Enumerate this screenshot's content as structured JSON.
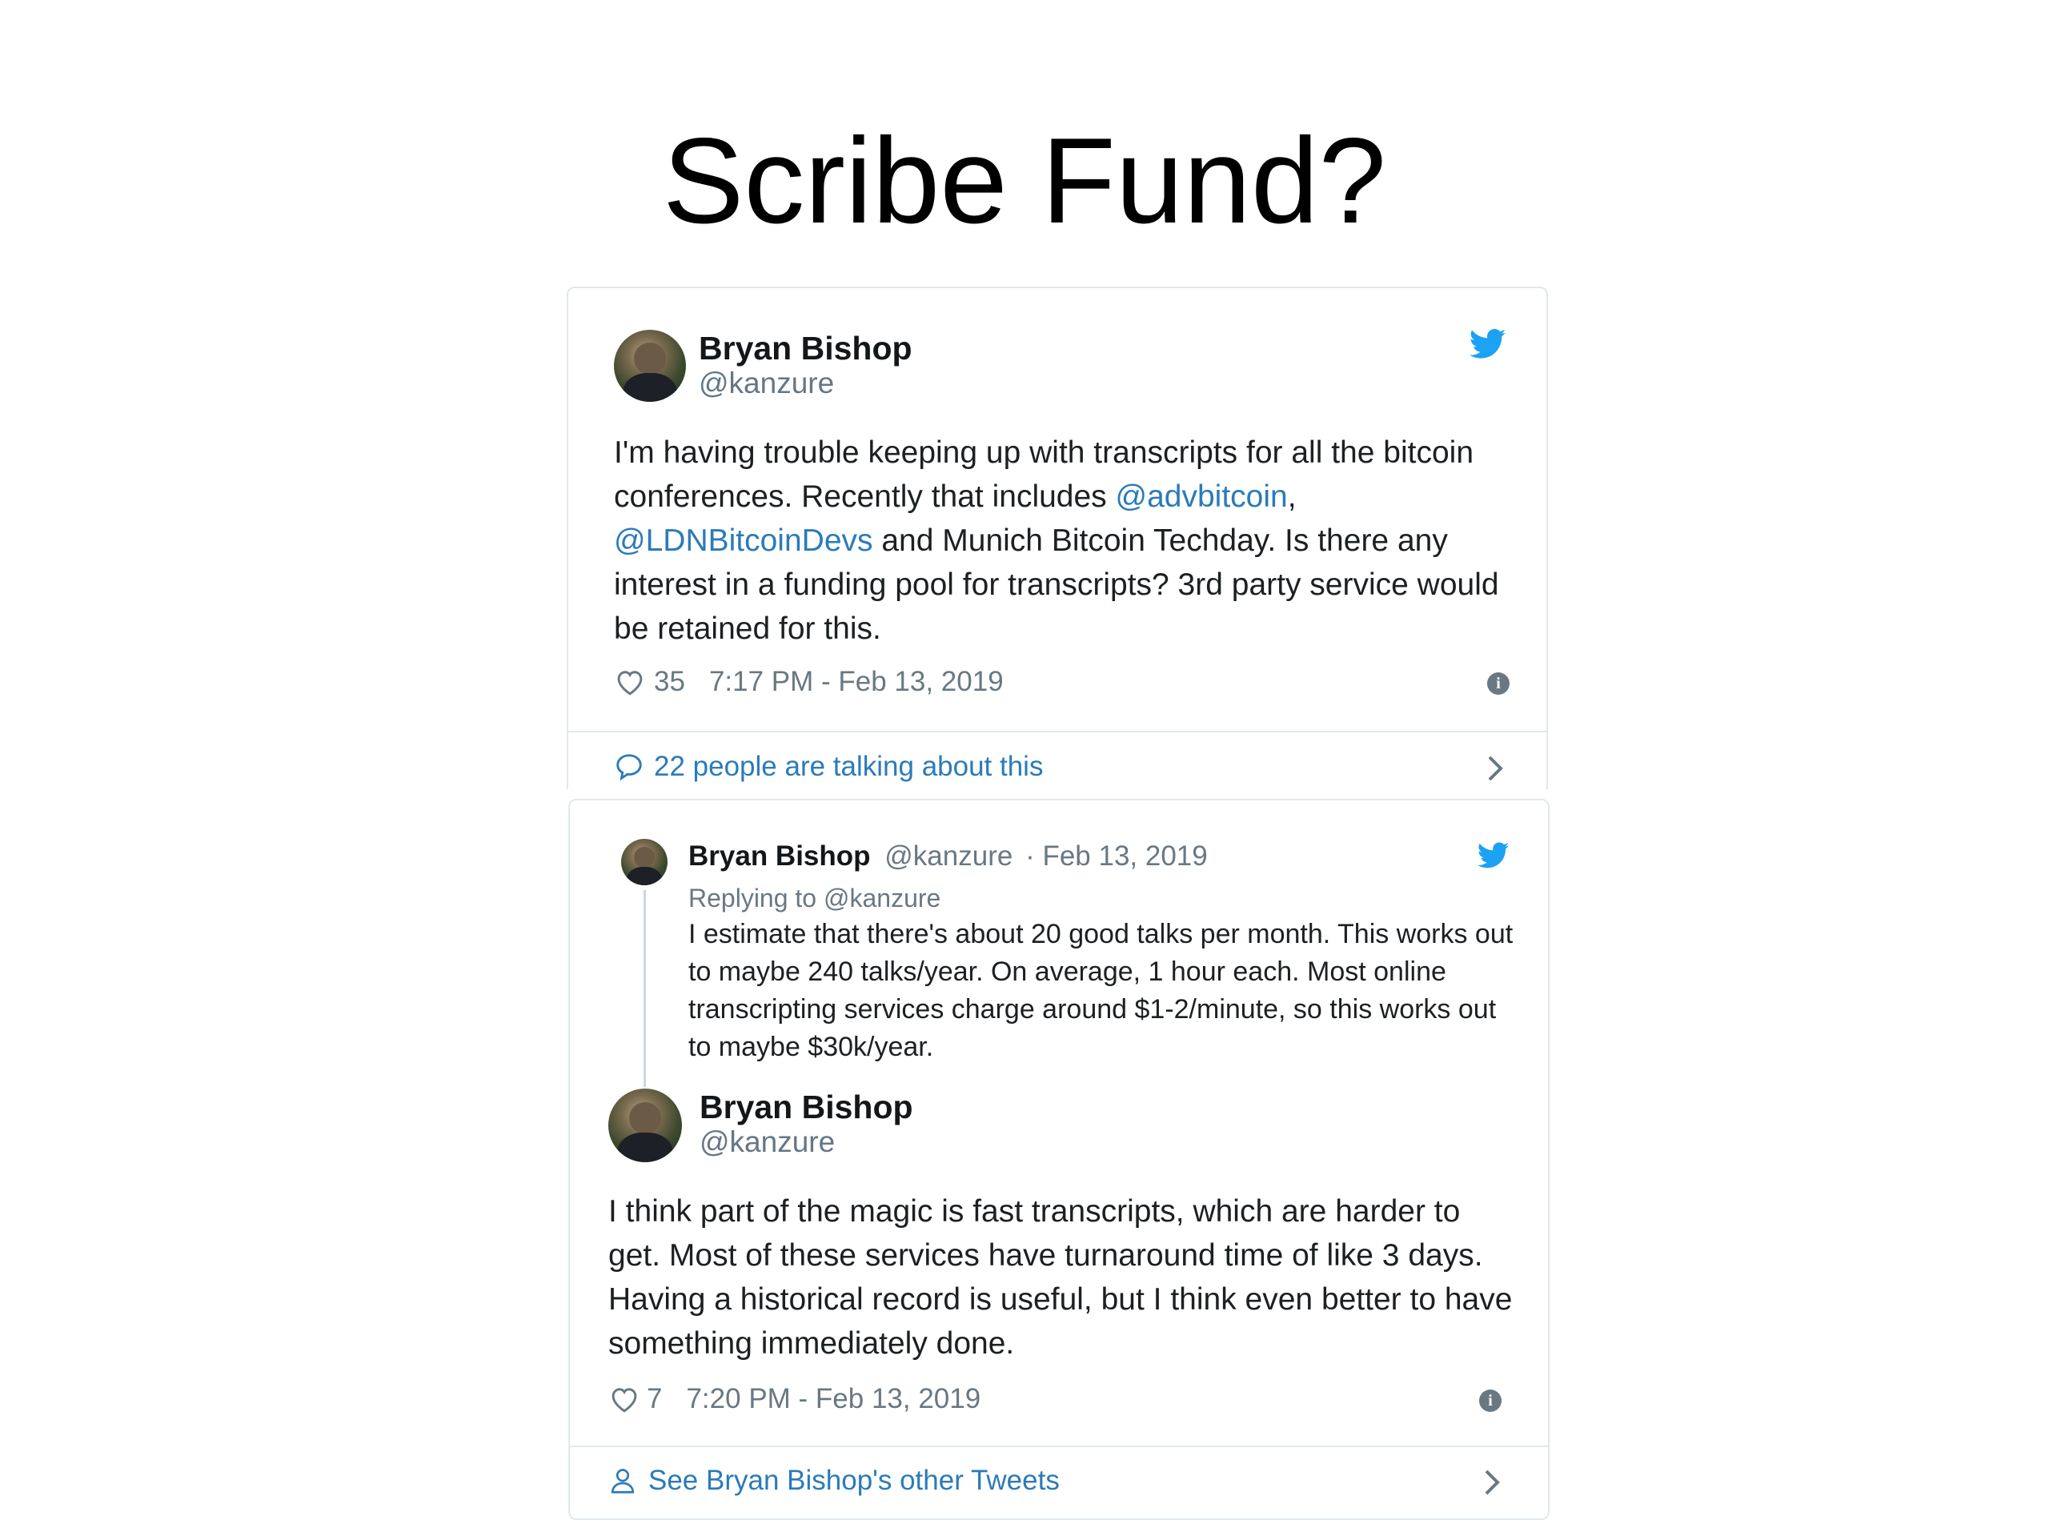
{
  "slide": {
    "title": "Scribe Fund?"
  },
  "tweet1": {
    "author_name": "Bryan Bishop",
    "author_handle": "@kanzure",
    "text_part1": "I'm having trouble keeping up with transcripts for all the bitcoin conferences. Recently that includes ",
    "mention1": "@advbitcoin",
    "comma": ",",
    "mention2": "@LDNBitcoinDevs",
    "text_part2": " and Munich Bitcoin Techday. Is there any interest in a funding pool for transcripts? 3rd party service would be retained for this.",
    "likes": "35",
    "timestamp": "7:17 PM - Feb 13, 2019",
    "conversation": "22 people are talking about this"
  },
  "tweet2": {
    "parent": {
      "author_name": "Bryan Bishop",
      "author_handle": "@kanzure",
      "date": "· Feb 13, 2019",
      "replying_to": "Replying to @kanzure",
      "text": "I estimate that there's about 20 good talks per month. This works out to maybe 240 talks/year. On average, 1 hour each. Most online transcripting services charge around $1-2/minute, so this works out to maybe $30k/year."
    },
    "author_name": "Bryan Bishop",
    "author_handle": "@kanzure",
    "text": "I think part of the magic is fast transcripts, which are harder to get. Most of these services have turnaround time of like 3 days. Having a historical record is useful, but I think even better to have something immediately done.",
    "likes": "7",
    "timestamp": "7:20 PM - Feb 13, 2019",
    "footer": "See Bryan Bishop's other Tweets"
  },
  "icons": {
    "brand": "twitter-bird-icon",
    "like": "heart-icon",
    "info": "info-icon",
    "comment": "speech-bubble-icon",
    "profile": "person-icon",
    "chevron": "chevron-right-icon"
  },
  "colors": {
    "link": "#2b7bb9",
    "bird": "#1da1f2",
    "muted": "#697882",
    "border": "#e1e8ed"
  }
}
